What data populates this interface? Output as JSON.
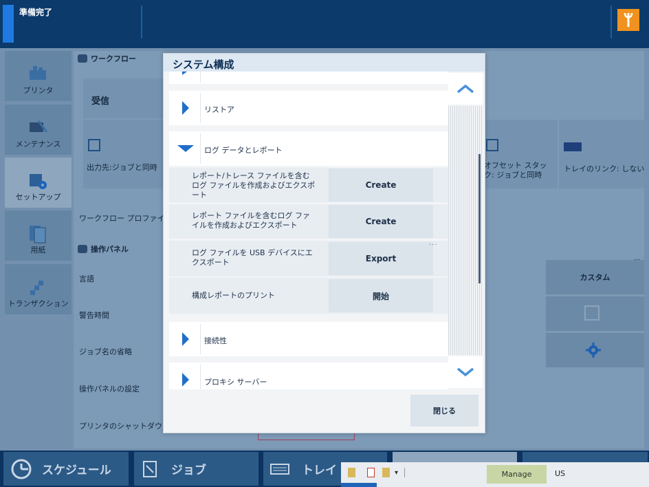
{
  "status_bar": {
    "status": "準備完了"
  },
  "left_nav": [
    {
      "label": "プリンタ",
      "icon": "printer-icon"
    },
    {
      "label": "メンテナンス",
      "icon": "maintenance-icon"
    },
    {
      "label": "セットアップ",
      "icon": "setup-icon",
      "selected": true
    },
    {
      "label": "用紙",
      "icon": "paper-icon"
    },
    {
      "label": "トランザクション",
      "icon": "transaction-icon"
    }
  ],
  "background": {
    "workflow_header": "ワークフロー",
    "receive": "受信",
    "output_dest": "出力先:ジョブと同時",
    "offset_stack": "オフセット スタック: ジョブと同時",
    "tray_link": "トレイのリンク: しない",
    "workflow_profile": "ワークフロー プロファイル",
    "panel_header": "操作パネル",
    "language": "言語",
    "warning_time": "警告時間",
    "job_name_abbr": "ジョブ名の省略",
    "panel_settings": "操作パネルの設定",
    "printer_shutdown": "プリンタのシャットダウン",
    "custom": "カスタム"
  },
  "dialog": {
    "title": "システム構成",
    "restore": "リストア",
    "log_data": "ログ データとレポート",
    "sub_items": [
      {
        "label": "レポート/トレース ファイルを含むログ ファイルを作成およびエクスポート",
        "action": "Create"
      },
      {
        "label": "レポート ファイルを含むログ ファイルを作成およびエクスポート",
        "action": "Create"
      },
      {
        "label": "ログ ファイルを USB デバイスにエクスポート",
        "action": "Export"
      },
      {
        "label": "構成レポートのプリント",
        "action": "開始"
      }
    ],
    "connectivity": "接続性",
    "proxy": "プロキシ サーバー",
    "close": "閉じる",
    "more": "..."
  },
  "bottom_bar": {
    "schedule": "スケジュール",
    "jobs": "ジョブ",
    "tray": "トレイ"
  },
  "taskbar": {
    "manage": "Manage",
    "locale": "US"
  },
  "colors": {
    "brand_blue": "#0b3a6b",
    "accent": "#1e7ae0",
    "service_orange": "#f0921f"
  }
}
